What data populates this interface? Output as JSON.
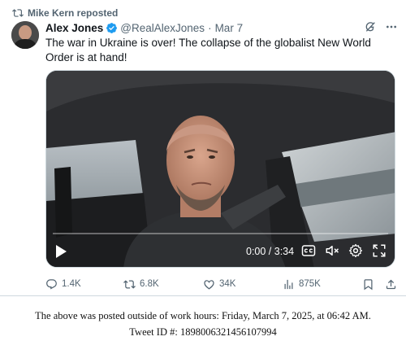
{
  "repost": {
    "text": "Mike Kern reposted"
  },
  "tweet": {
    "author_name": "Alex Jones",
    "handle": "@RealAlexJones",
    "separator": "·",
    "date": "Mar 7",
    "text": "The war in Ukraine is over! The collapse of the globalist New World Order is at hand!"
  },
  "video": {
    "time": "0:00 / 3:34",
    "progress": 0
  },
  "actions": {
    "replies": "1.4K",
    "reposts": "6.8K",
    "likes": "34K",
    "views": "875K"
  },
  "footer": {
    "line1": "The above was posted outside of work hours: Friday, March 7, 2025, at 06:42 AM.",
    "line2": "Tweet ID #: 1898006321456107994"
  },
  "colors": {
    "secondary_text": "#536471",
    "verified_blue": "#1d9bf0",
    "border": "#cfd9de"
  },
  "icons": [
    "repost-icon",
    "verified-badge-icon",
    "grok-icon",
    "more-icon",
    "play-icon",
    "captions-icon",
    "mute-icon",
    "settings-icon",
    "fullscreen-icon",
    "reply-icon",
    "like-icon",
    "views-icon",
    "bookmark-icon",
    "share-icon"
  ]
}
